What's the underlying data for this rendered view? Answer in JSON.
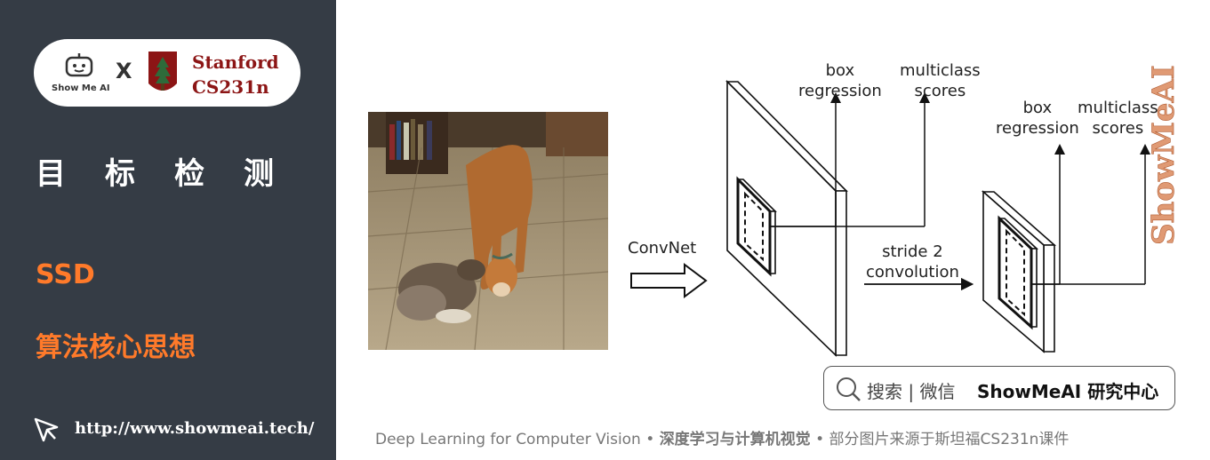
{
  "brand": {
    "showme_label": "Show Me AI",
    "cross": "X",
    "stanford_line1": "Stanford",
    "stanford_line2": "CS231n"
  },
  "sidebar": {
    "section_title": "目标检测",
    "topic": "SSD",
    "subtopic": "算法核心思想",
    "url": "http://www.showmeai.tech/"
  },
  "diagram": {
    "convnet_label": "ConvNet",
    "box_regression_1": "box\nregression",
    "multiclass_scores_1": "multiclass\nscores",
    "stride_label": "stride 2\nconvolution",
    "box_regression_2": "box\nregression",
    "multiclass_scores_2": "multiclass\nscores"
  },
  "watermark": "ShowMeAI",
  "search": {
    "prefix": "搜索 | 微信",
    "brand": "ShowMeAI 研究中心"
  },
  "footer": {
    "course": "Deep Learning for Computer Vision",
    "sep1": " • ",
    "cn_course": "深度学习与计算机视觉",
    "sep2": " • ",
    "source": "部分图片来源于斯坦福CS231n课件"
  },
  "colors": {
    "sidebar_bg": "#353c45",
    "accent_orange": "#ff7a2a",
    "stanford_red": "#8c1515"
  }
}
